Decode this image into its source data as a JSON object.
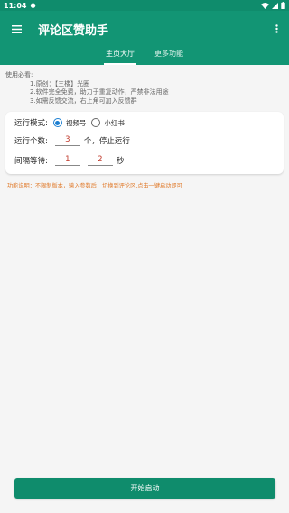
{
  "status_bar": {
    "time": "11:04",
    "notification_icon": "android-icon",
    "icons": [
      "wifi-icon",
      "signal-icon",
      "battery-icon"
    ]
  },
  "app_bar": {
    "title": "评论区赞助手"
  },
  "tabs": [
    {
      "label": "主页大厅",
      "active": true
    },
    {
      "label": "更多功能",
      "active": false
    }
  ],
  "notes": {
    "heading": "使用必看:",
    "lines": [
      "1.原创：【三楼】光圈",
      "2.软件完全免费，助力于重复动作，严禁非法用途",
      "3.如需反馈交流，右上角可加入反馈群"
    ]
  },
  "settings": {
    "mode_label": "运行模式:",
    "mode_options": [
      "视频号",
      "小红书"
    ],
    "selected_mode": "视频号",
    "count_label": "运行个数:",
    "count_value": "3",
    "count_suffix": "个，停止运行",
    "interval_label": "间隔等待:",
    "interval_min": "1",
    "interval_max": "2",
    "interval_unit": "秒"
  },
  "function_note": "功能说明：不限制版本，输入参数后，切换到评论区,点击一键启动即可",
  "start_button": "开始启动",
  "colors": {
    "primary": "#129574",
    "status_bar": "#0f8c6c",
    "radio_accent": "#1a7ed1",
    "number_text": "#c0392b",
    "note_orange": "#e07a2b"
  }
}
